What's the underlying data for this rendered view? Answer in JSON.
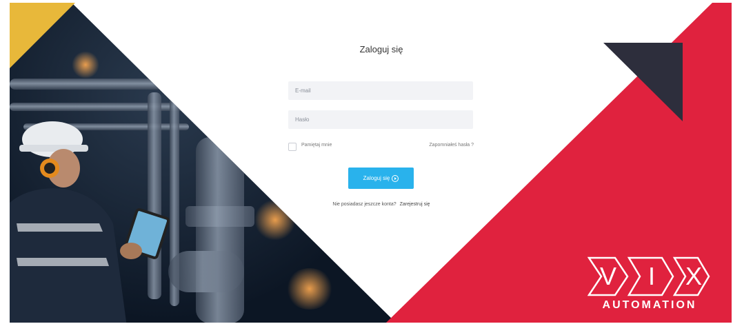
{
  "login": {
    "title": "Zaloguj się",
    "email_placeholder": "E-mail",
    "password_placeholder": "Hasło",
    "remember_label": "Pamiętaj mnie",
    "forgot_link": "Zapomniałeś hasła ?",
    "submit_label": "Zaloguj się",
    "no_account_text": "Nie posiadasz jeszcze konta?",
    "register_link": "Zarejestruj się"
  },
  "branding": {
    "logo_letters": "VIX",
    "logo_text": "AUTOMATION"
  },
  "colors": {
    "accent_red": "#e0223e",
    "accent_yellow": "#e8b83a",
    "dark_navy": "#2d2e3c",
    "button_blue": "#29b2ec",
    "field_bg": "#f2f3f6"
  },
  "icons": {
    "submit": "arrow-circle-right-icon",
    "logo": "vix-logo"
  }
}
